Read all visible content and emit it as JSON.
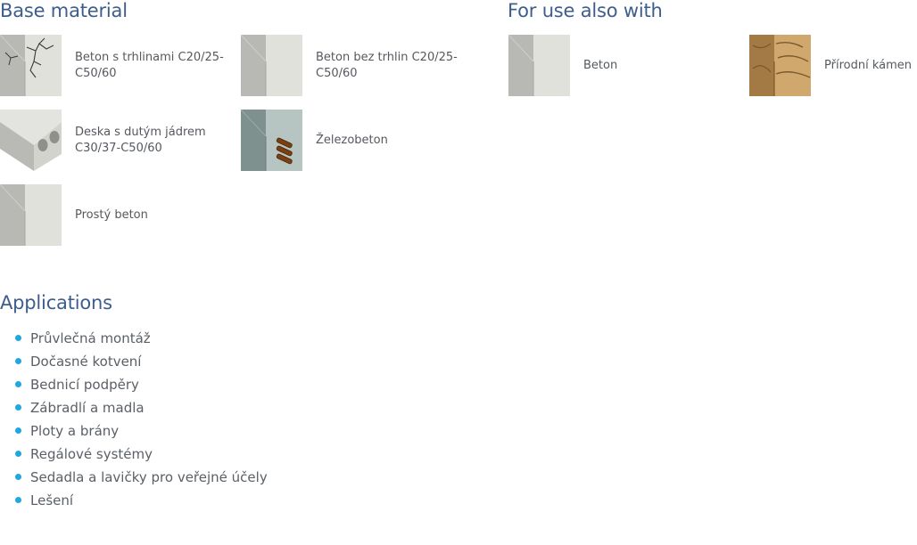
{
  "sections": {
    "base_material": "Base material",
    "use_also": "For use also with",
    "applications": "Applications"
  },
  "base_materials": [
    {
      "label": "Beton s trhlinami C20/25-C50/60",
      "icon": "cracked-concrete-icon"
    },
    {
      "label": "Beton bez trhlin C20/25-C50/60",
      "icon": "uncracked-concrete-icon"
    },
    {
      "label": "Deska s dutým jádrem C30/37-C50/60",
      "icon": "hollow-core-slab-icon"
    },
    {
      "label": "Železobeton",
      "icon": "reinforced-concrete-icon"
    },
    {
      "label": "Prostý beton",
      "icon": "plain-concrete-icon"
    }
  ],
  "use_also": [
    {
      "label": "Beton",
      "icon": "concrete-icon"
    },
    {
      "label": "Přírodní kámen",
      "icon": "natural-stone-icon"
    }
  ],
  "applications": [
    "Průvlečná montáž",
    "Dočasné kotvení",
    "Bednicí podpěry",
    "Zábradlí a madla",
    "Ploty a brány",
    "Regálové systémy",
    "Sedadla a lavičky pro veřejné účely",
    "Lešení"
  ],
  "colors": {
    "heading": "#3d5e8c",
    "bullet": "#1fa8e0",
    "text": "#55595e"
  }
}
